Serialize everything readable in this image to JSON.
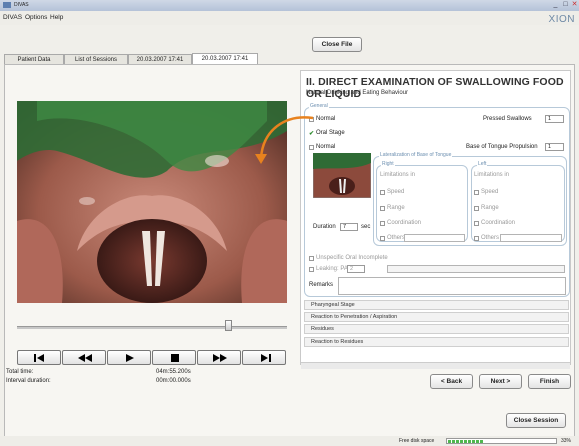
{
  "window": {
    "title": "DIVAS"
  },
  "menu": {
    "items": [
      "DIVAS",
      "Options",
      "Help"
    ]
  },
  "logo_text": "XION",
  "buttons": {
    "close_file": "Close File",
    "back": "< Back",
    "next": "Next >",
    "finish": "Finish",
    "close_session": "Close Session"
  },
  "tabs": [
    "Patient Data",
    "List of Sessions",
    "20.03.2007 17:41",
    "20.03.2007 17:41"
  ],
  "active_tab_index": 3,
  "player": {
    "slider_position": 0.78,
    "total_time_label": "Total time:",
    "total_time_value": "04m:55.200s",
    "interval_label": "Interval duration:",
    "interval_value": "00m:00.000s",
    "controls": [
      "skip-to-start",
      "rewind",
      "play",
      "stop",
      "fast-forward",
      "skip-to-end"
    ]
  },
  "form": {
    "heading": "II. DIRECT EXAMINATION OF SWALLOWING FOOD OR LIQUID",
    "subheading": "Natural Drinking and Eating Behaviour",
    "general_legend": "General",
    "normal_label": "Normal",
    "pressed_swallows_label": "Pressed Swallows",
    "pressed_swallows_value": "1",
    "oral_stage_label": "Oral Stage",
    "oral_normal_label": "Normal",
    "base_tongue_label": "Base of Tongue Propulsion",
    "base_tongue_value": "1",
    "lateralization_legend": "Lateralization of Base of Tongue",
    "right_legend": "Right",
    "left_legend": "Left",
    "limitations_label": "Limitations in",
    "limitation_items": [
      "Speed",
      "Range",
      "Coordination",
      "Others"
    ],
    "duration_label": "Duration",
    "duration_value": "7",
    "duration_unit": "sec",
    "unspecific_label": "Unspecific Oral Incomplete",
    "leaking_label": "Leaking: PAS",
    "leaking_value": "2",
    "remarks_label": "Remarks",
    "sections": [
      "Pharyngeal Stage",
      "Reaction to Penetration / Aspiration",
      "Residues",
      "Reaction to Residues"
    ]
  },
  "status": {
    "free_disk_label": "Free disk space",
    "free_disk_percent": 33,
    "free_disk_text": "33%"
  },
  "colors": {
    "accent_orange": "#e8821e",
    "legend_blue": "#6c8fb0",
    "progress_green": "#4fb84f"
  }
}
